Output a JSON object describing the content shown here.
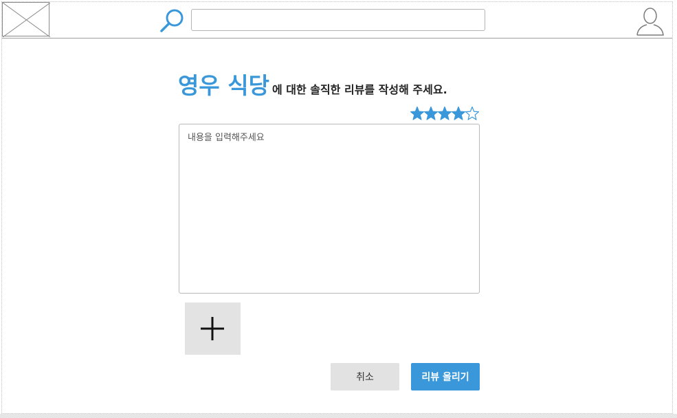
{
  "header": {
    "search_placeholder": ""
  },
  "review": {
    "restaurant_name": "영우 식당",
    "title_suffix": "에 대한 솔직한 리뷰를 작성해 주세요.",
    "rating": 4,
    "rating_max": 5,
    "content_placeholder": "내용을 입력해주세요"
  },
  "actions": {
    "cancel_label": "취소",
    "submit_label": "리뷰 올리기"
  },
  "colors": {
    "accent": "#3a98da",
    "button_gray": "#e2e2e2",
    "photo_tile": "#e3e3e3"
  },
  "icons": {
    "logo": "image-placeholder-icon",
    "search": "search-icon",
    "user": "user-icon",
    "add": "plus-icon",
    "star": "star-icon"
  }
}
